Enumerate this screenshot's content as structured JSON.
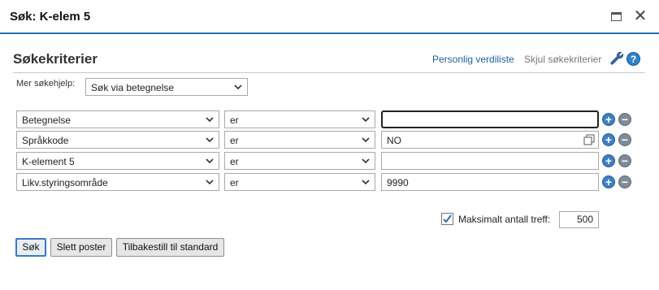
{
  "window": {
    "title": "Søk: K-elem 5",
    "maximize_icon": "maximize-icon",
    "close_glyph": "✕"
  },
  "header": {
    "title": "Søkekriterier",
    "personal_list_link": "Personlig verdiliste",
    "hide_criteria_link": "Skjul søkekriterier",
    "help_glyph": "?"
  },
  "helper": {
    "label": "Mer søkehjelp:",
    "selected": "Søk via betegnelse"
  },
  "criteria": [
    {
      "field": "Betegnelse",
      "operator": "er",
      "value": ""
    },
    {
      "field": "Språkkode",
      "operator": "er",
      "value": "NO"
    },
    {
      "field": "K-element 5",
      "operator": "er",
      "value": ""
    },
    {
      "field": "Likv.styringsområde",
      "operator": "er",
      "value": "9990"
    }
  ],
  "row_buttons": {
    "add": "+",
    "remove": "−"
  },
  "max_hits": {
    "checked": true,
    "label": "Maksimalt antall treff:",
    "value": "500"
  },
  "buttons": {
    "search": "Søk",
    "delete": "Slett poster",
    "reset": "Tilbakestill til standard"
  },
  "colors": {
    "accent": "#1f6fb8",
    "link": "#1f5f9a",
    "add_button": "#3f7ec2",
    "remove_button": "#7f8c97"
  }
}
